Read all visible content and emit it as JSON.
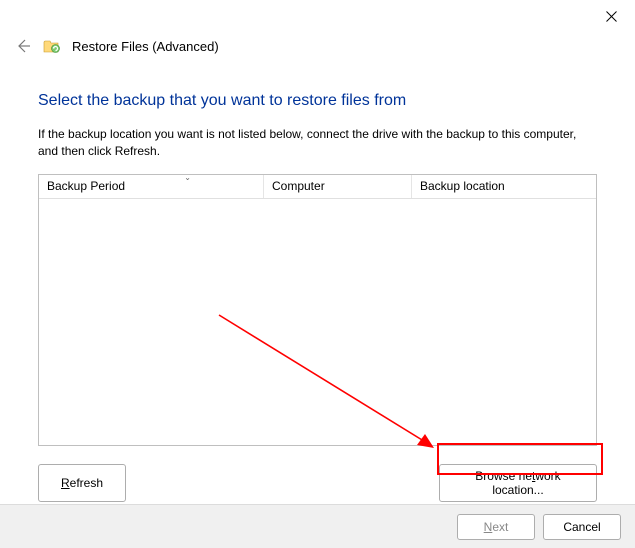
{
  "titlebar": {
    "close_label": "Close"
  },
  "header": {
    "back_label": "Back",
    "title": "Restore Files (Advanced)"
  },
  "main": {
    "heading": "Select the backup that you want to restore files from",
    "description": "If the backup location you want is not listed below, connect the drive with the backup to this computer, and then click Refresh.",
    "columns": {
      "backup_period": "Backup Period",
      "computer": "Computer",
      "backup_location": "Backup location"
    },
    "refresh_label": "Refresh",
    "refresh_underline_char": "R",
    "refresh_rest": "efresh",
    "browse_label": "Browse network location...",
    "browse_pre": "Browse ne",
    "browse_underline_char": "t",
    "browse_post": "work location..."
  },
  "footer": {
    "next_label": "Next",
    "next_underline_char": "N",
    "next_rest": "ext",
    "cancel_label": "Cancel"
  }
}
